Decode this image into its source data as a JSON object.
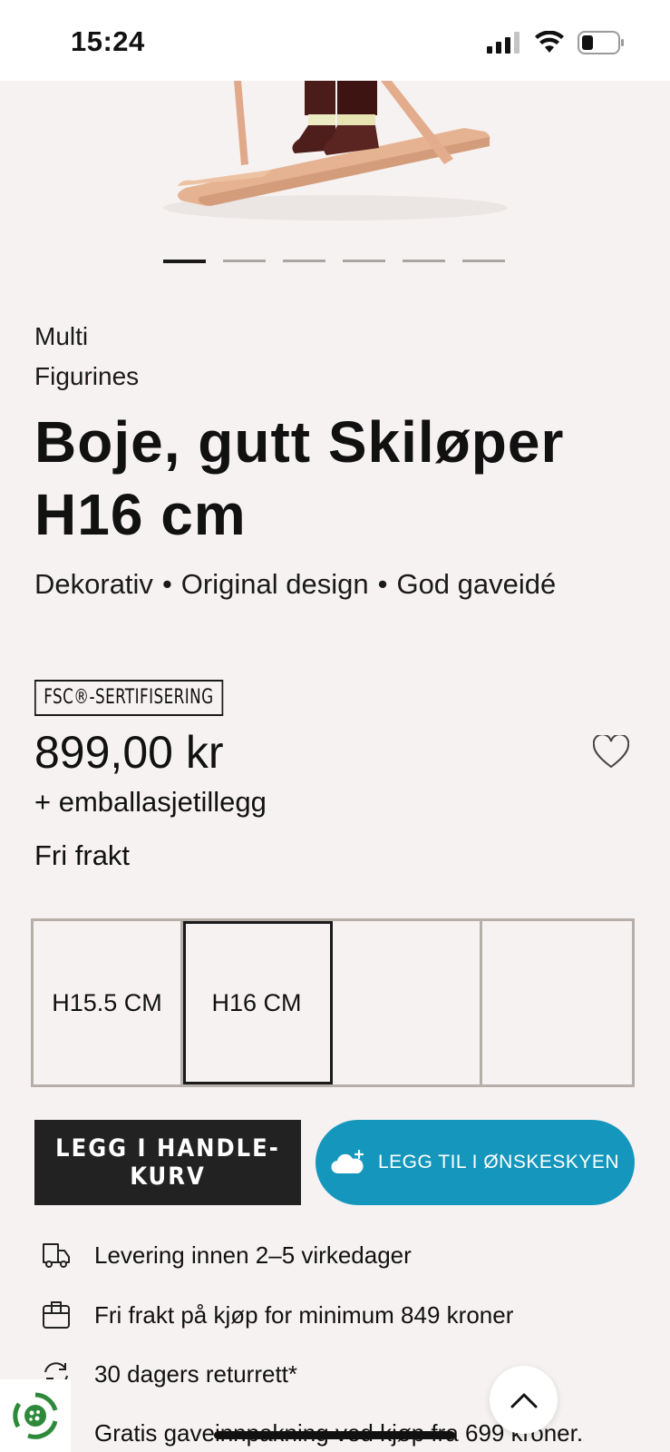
{
  "status_bar": {
    "time": "15:24"
  },
  "carousel": {
    "count": 6,
    "active_index": 0
  },
  "product": {
    "brand": "Multi",
    "category": "Figurines",
    "title": "Boje, gutt Skiløper H16 cm",
    "tags": [
      "Dekorativ",
      "Original design",
      "God gaveidé"
    ],
    "badge": "FSC®-SERTIFISERING",
    "price": "899,00 kr",
    "packaging_note": "+ emballasjetillegg",
    "shipping_note": "Fri frakt"
  },
  "variants": [
    {
      "label": "H15.5 CM",
      "selected": false
    },
    {
      "label": "H16 CM",
      "selected": true
    },
    {
      "label": "",
      "selected": false
    },
    {
      "label": "",
      "selected": false
    }
  ],
  "actions": {
    "add_to_cart": "LEGG I HANDLE-KURV",
    "add_to_wishlist": "LEGG TIL I ØNSKESKYEN"
  },
  "usps": [
    {
      "icon": "truck-icon",
      "text": "Levering innen 2–5 virkedager"
    },
    {
      "icon": "box-icon",
      "text": "Fri frakt på kjøp for minimum 849 kroner"
    },
    {
      "icon": "return-icon",
      "text": "30 dagers returrett*"
    },
    {
      "icon": "gift-icon",
      "text": "Gratis gaveinnpakning ved kjøp fra 699 kroner."
    }
  ],
  "colors": {
    "background": "#f6f2f1",
    "cart_button": "#222222",
    "wishlist_button": "#1597bd"
  }
}
